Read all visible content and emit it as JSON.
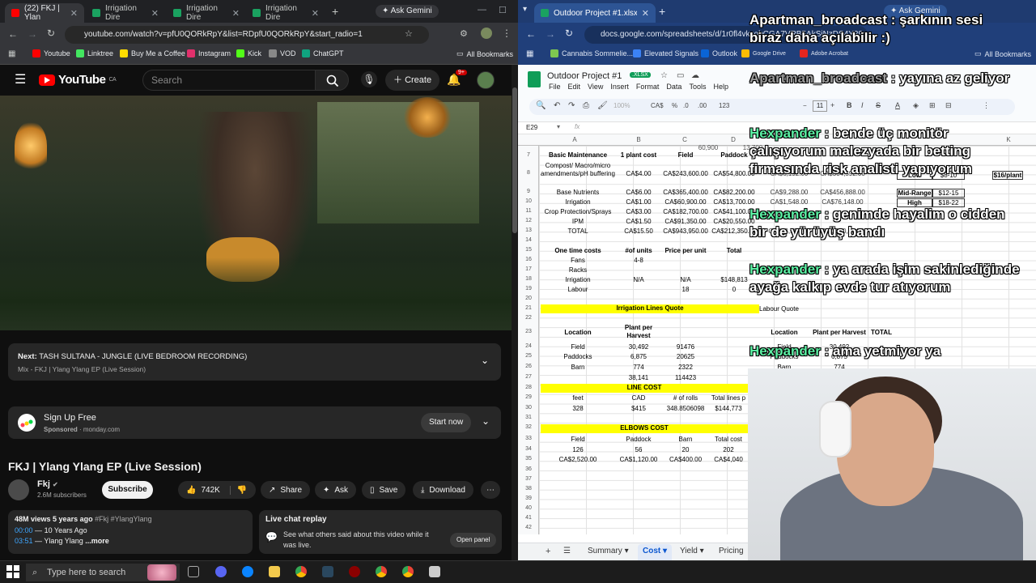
{
  "left_browser": {
    "tabs": [
      {
        "label": "(22) FKJ | Ylan",
        "favicon": "youtube-icon",
        "active": true
      },
      {
        "label": "Irrigation Dire",
        "favicon": "sheets-icon"
      },
      {
        "label": "Irrigation Dire",
        "favicon": "sheets-icon"
      },
      {
        "label": "Irrigation Dire",
        "favicon": "sheets-icon"
      }
    ],
    "new_tab": "+",
    "ask_gemini": "Ask Gemini",
    "url": "youtube.com/watch?v=pfU0QORkRpY&list=RDpfU0QORkRpY&start_radio=1",
    "bookmarks": [
      "Youtube",
      "Linktree",
      "Buy Me a Coffee",
      "Instagram",
      "Kick",
      "VOD",
      "ChatGPT"
    ],
    "all_bookmarks": "All Bookmarks"
  },
  "youtube": {
    "logo": "YouTube",
    "country": "CA",
    "search_placeholder": "Search",
    "create": "Create",
    "notif_count": "9+",
    "next_label": "Next:",
    "next_title": "TASH SULTANA - JUNGLE (LIVE BEDROOM RECORDING)",
    "next_sub": "Mix - FKJ  |  Ylang Ylang EP (Live Session)",
    "sponsor_title": "Sign Up Free",
    "sponsor_sub": "Sponsored",
    "sponsor_domain": "monday.com",
    "sponsor_cta": "Start now",
    "video_title": "FKJ | Ylang Ylang EP (Live Session)",
    "channel": "Fkj",
    "subscribers": "2.6M subscribers",
    "subscribe": "Subscribe",
    "likes": "742K",
    "share": "Share",
    "ask": "Ask",
    "save": "Save",
    "download": "Download",
    "views": "48M views",
    "age": "5 years ago",
    "tags": "#Fkj #YlangYlang",
    "chapters": [
      {
        "time": "00:00",
        "label": "10 Years Ago"
      },
      {
        "time": "03:51",
        "label": "Ylang Ylang"
      }
    ],
    "more": "...more",
    "chat_title": "Live chat replay",
    "chat_desc": "See what others said about this video while it was live.",
    "chat_btn": "Open panel"
  },
  "right_browser": {
    "tab_label": "Outdoor Project #1.xlsx - Goog",
    "ask_gemini": "Ask Gemini",
    "url": "docs.google.com/spreadsheets/d/1r0fl4vkxobCGA7VRB5AkSjNzDS4Y29cJ/edit?",
    "bookmarks": [
      "Cannabis Sommelie...",
      "Elevated Signals",
      "Outlook",
      "Google Drive",
      "Adobe Acrobat"
    ],
    "all_bookmarks": "All Bookmarks"
  },
  "sheet": {
    "title": "Outdoor Project #1",
    "badge": ".XLSX",
    "menu": [
      "File",
      "Edit",
      "View",
      "Insert",
      "Format",
      "Data",
      "Tools",
      "Help"
    ],
    "zoom": "100%",
    "currency": "CA$",
    "percent": "%",
    "decimals": ".0",
    "decimals2": ".00",
    "numfmt": "123",
    "font_size": "11",
    "cell_ref": "E29",
    "columns": [
      "A",
      "B",
      "C",
      "D",
      "K"
    ],
    "rows": [
      "7",
      "8",
      "9",
      "10",
      "11",
      "12",
      "13",
      "14",
      "15",
      "16",
      "17",
      "18",
      "19",
      "20",
      "21",
      "22",
      "23",
      "24",
      "25",
      "26",
      "27",
      "28",
      "29",
      "30",
      "31",
      "32",
      "33",
      "34",
      "35",
      "36",
      "37",
      "38",
      "39",
      "40",
      "41",
      "42"
    ],
    "maint_header": [
      "Basic Maintenance",
      "1 plant cost",
      "Field",
      "Paddock"
    ],
    "maint_rows": [
      [
        "Compost/ Macro/micro amendments/pH buffering",
        "CA$4.00",
        "CA$243,600.00",
        "CA$54,800.00"
      ],
      [
        "Base Nutrients",
        "CA$6.00",
        "CA$365,400.00",
        "CA$82,200.00"
      ],
      [
        "Irrigation",
        "CA$1.00",
        "CA$60,900.00",
        "CA$13,700.00"
      ],
      [
        "Crop Protection/Sprays",
        "CA$3.00",
        "CA$182,700.00",
        "CA$41,100.00"
      ],
      [
        "IPM",
        "CA$1.50",
        "CA$91,350.00",
        "CA$20,550.00"
      ],
      [
        "TOTAL",
        "CA$15.50",
        "CA$943,950.00",
        "CA$212,350.00"
      ]
    ],
    "hidden_top": [
      "60,900",
      "13,700"
    ],
    "right_cols": [
      "CA$6,192.00",
      "CA$304,592.00",
      "CA$9,288.00",
      "CA$456,888.00",
      "CA$1,548.00",
      "CA$76,148.00",
      "CA$23,994.00",
      "CA$1,180,294.00"
    ],
    "price_labels": [
      "Low",
      "Mid-Range",
      "High"
    ],
    "price_values": [
      "$8-10",
      "$12-15",
      "$18-22"
    ],
    "per_plant": "$16/plant",
    "one_time_header": [
      "One time costs",
      "#of units",
      "Price per unit",
      "Total"
    ],
    "one_time_rows": [
      [
        "Fans",
        "4-8",
        "",
        ""
      ],
      [
        "Racks",
        "",
        "",
        ""
      ],
      [
        "Irrigation",
        "N/A",
        "N/A",
        "$148,813"
      ],
      [
        "Labour",
        "",
        "18",
        "0"
      ]
    ],
    "irrigation_title": "Irrigation Lines Quote",
    "labour_quote": "Labour Quote",
    "loc_header": [
      "Location",
      "Plant per Harvest"
    ],
    "loc_rows": [
      [
        "Field",
        "30,492",
        "91476"
      ],
      [
        "Paddocks",
        "6,875",
        "20625"
      ],
      [
        "Barn",
        "774",
        "2322"
      ]
    ],
    "loc_total": [
      "38,141",
      "114423"
    ],
    "loc2_header": [
      "Location",
      "Plant per Harvest",
      "TOTAL"
    ],
    "loc2_rows": [
      [
        "Field",
        "30,492"
      ],
      [
        "Paddocks",
        "6,875"
      ],
      [
        "Barn",
        "774"
      ]
    ],
    "line_cost_title": "LINE COST",
    "line_header": [
      "feet",
      "CAD",
      "# of rolls",
      "Total lines p"
    ],
    "line_row": [
      "328",
      "$415",
      "348.8506098",
      "$144,773"
    ],
    "elbows_title": "ELBOWS COST",
    "elbows_header": [
      "Field",
      "Paddock",
      "Barn",
      "Total cost"
    ],
    "elbows_row1": [
      "126",
      "56",
      "20",
      "202"
    ],
    "elbows_row2": [
      "CA$2,520.00",
      "CA$1,120.00",
      "CA$400.00",
      "CA$4,040"
    ],
    "sheet_tabs": [
      "Summary",
      "Cost",
      "Yield",
      "Pricing"
    ],
    "active_tab": "Cost"
  },
  "stream_chat": [
    {
      "user": "Apartman_broadcast",
      "msg": "şarkının sesi biraz daha açılabilir :)",
      "user_color": "white"
    },
    {
      "user": "Apartman_broadcast",
      "msg": "yayına az geliyor",
      "user_color": "grey"
    },
    {
      "user": "Hexpander",
      "msg": "bende üç monitör çalışıyorum malezyada bir betting firmasında risk analisti yapıyorum",
      "user_color": "green"
    },
    {
      "user": "Hexpander",
      "msg": "genimde hayalim o cidden bir de yürüyüş bandı",
      "user_color": "green"
    },
    {
      "user": "Hexpander",
      "msg": "ya arada işim sakinlediğinde ayağa kalkıp evde tur atıyorum",
      "user_color": "green"
    },
    {
      "user": "Hexpander",
      "msg": "ama yetmiyor ya",
      "user_color": "green"
    }
  ],
  "taskbar": {
    "search_placeholder": "Type here to search"
  },
  "colors": {
    "yt_red": "#ff0000",
    "sheets_green": "#0f9d58",
    "chat_green": "#5cf0a4",
    "highlight_yellow": "#ffff00"
  }
}
